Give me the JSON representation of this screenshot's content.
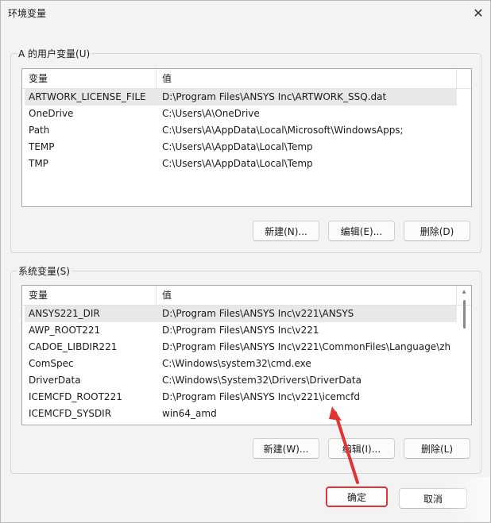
{
  "window": {
    "title": "环境变量"
  },
  "user_vars": {
    "group_label": "A 的用户变量(U)",
    "col_variable": "变量",
    "col_value": "值",
    "rows": [
      {
        "name": "ARTWORK_LICENSE_FILE",
        "value": "D:\\Program Files\\ANSYS Inc\\ARTWORK_SSQ.dat",
        "selected": true
      },
      {
        "name": "OneDrive",
        "value": "C:\\Users\\A\\OneDrive"
      },
      {
        "name": "Path",
        "value": "C:\\Users\\A\\AppData\\Local\\Microsoft\\WindowsApps;"
      },
      {
        "name": "TEMP",
        "value": "C:\\Users\\A\\AppData\\Local\\Temp"
      },
      {
        "name": "TMP",
        "value": "C:\\Users\\A\\AppData\\Local\\Temp"
      }
    ],
    "buttons": {
      "new": "新建(N)...",
      "edit": "编辑(E)...",
      "delete": "删除(D)"
    }
  },
  "system_vars": {
    "group_label": "系统变量(S)",
    "col_variable": "变量",
    "col_value": "值",
    "rows": [
      {
        "name": "ANSYS221_DIR",
        "value": "D:\\Program Files\\ANSYS Inc\\v221\\ANSYS",
        "selected": true
      },
      {
        "name": "AWP_ROOT221",
        "value": "D:\\Program Files\\ANSYS Inc\\v221"
      },
      {
        "name": "CADOE_LIBDIR221",
        "value": "D:\\Program Files\\ANSYS Inc\\v221\\CommonFiles\\Language\\zh"
      },
      {
        "name": "ComSpec",
        "value": "C:\\Windows\\system32\\cmd.exe"
      },
      {
        "name": "DriverData",
        "value": "C:\\Windows\\System32\\Drivers\\DriverData"
      },
      {
        "name": "ICEMCFD_ROOT221",
        "value": "D:\\Program Files\\ANSYS Inc\\v221\\icemcfd"
      },
      {
        "name": "ICEMCFD_SYSDIR",
        "value": "win64_amd"
      }
    ],
    "buttons": {
      "new": "新建(W)...",
      "edit": "编辑(I)...",
      "delete": "删除(L)"
    }
  },
  "footer": {
    "ok": "确定",
    "cancel": "取消"
  },
  "colors": {
    "annotation": "#e03535",
    "selection": "#e8e8e8"
  },
  "icons": {
    "close": "close-icon"
  }
}
